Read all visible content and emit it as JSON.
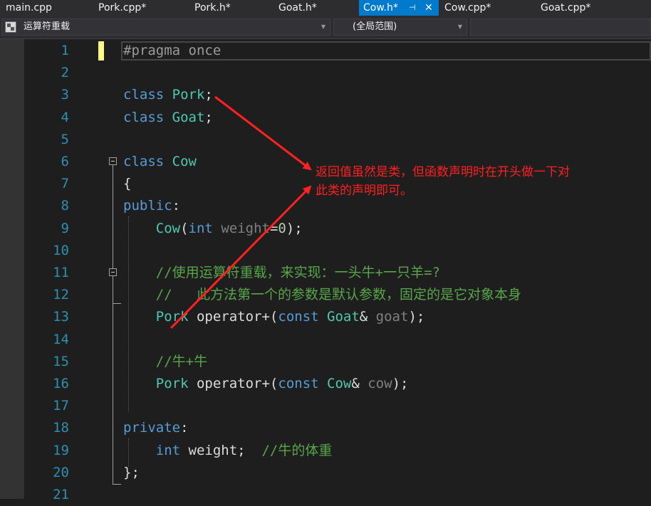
{
  "tabs": [
    {
      "label": "main.cpp"
    },
    {
      "label": "Pork.cpp*"
    },
    {
      "label": "Pork.h*"
    },
    {
      "label": "Goat.h*"
    },
    {
      "label": "Cow.h*",
      "active": true
    },
    {
      "label": "Cow.cpp*"
    },
    {
      "label": "Goat.cpp*"
    }
  ],
  "navigation": {
    "member_combo": "运算符重载",
    "scope_combo": "(全局范围)"
  },
  "editor": {
    "line_numbers": [
      "1",
      "2",
      "3",
      "4",
      "5",
      "6",
      "7",
      "8",
      "9",
      "10",
      "11",
      "12",
      "13",
      "14",
      "15",
      "16",
      "17",
      "18",
      "19",
      "20",
      "21"
    ],
    "lines": [
      {
        "segments": [
          {
            "text": "#pragma once",
            "cls": "pp"
          }
        ]
      },
      {
        "segments": []
      },
      {
        "segments": [
          {
            "text": "class ",
            "cls": "kw"
          },
          {
            "text": "Pork",
            "cls": "ty"
          },
          {
            "text": ";",
            "cls": ""
          }
        ]
      },
      {
        "segments": [
          {
            "text": "class ",
            "cls": "kw"
          },
          {
            "text": "Goat",
            "cls": "ty"
          },
          {
            "text": ";",
            "cls": ""
          }
        ]
      },
      {
        "segments": []
      },
      {
        "segments": [
          {
            "text": "class ",
            "cls": "kw"
          },
          {
            "text": "Cow",
            "cls": "ty"
          }
        ]
      },
      {
        "segments": [
          {
            "text": "{",
            "cls": ""
          }
        ]
      },
      {
        "segments": [
          {
            "text": "public",
            "cls": "kw"
          },
          {
            "text": ":",
            "cls": ""
          }
        ]
      },
      {
        "segments": [
          {
            "text": "    ",
            "cls": ""
          },
          {
            "text": "Cow",
            "cls": "ty"
          },
          {
            "text": "(",
            "cls": ""
          },
          {
            "text": "int ",
            "cls": "kw"
          },
          {
            "text": "weight",
            "cls": "pa"
          },
          {
            "text": "=",
            "cls": ""
          },
          {
            "text": "0",
            "cls": "num"
          },
          {
            "text": ");",
            "cls": ""
          }
        ]
      },
      {
        "segments": []
      },
      {
        "segments": [
          {
            "text": "    //使用运算符重载，来实现：一头牛+一只羊=?",
            "cls": "cm"
          }
        ]
      },
      {
        "segments": [
          {
            "text": "    //   此方法第一个的参数是默认参数，固定的是它对象本身",
            "cls": "cm"
          }
        ]
      },
      {
        "segments": [
          {
            "text": "    ",
            "cls": ""
          },
          {
            "text": "Pork",
            "cls": "ty"
          },
          {
            "text": " operator+(",
            "cls": ""
          },
          {
            "text": "const ",
            "cls": "kw"
          },
          {
            "text": "Goat",
            "cls": "ty"
          },
          {
            "text": "& ",
            "cls": ""
          },
          {
            "text": "goat",
            "cls": "pa"
          },
          {
            "text": ");",
            "cls": ""
          }
        ]
      },
      {
        "segments": []
      },
      {
        "segments": [
          {
            "text": "    //牛+牛",
            "cls": "cm"
          }
        ]
      },
      {
        "segments": [
          {
            "text": "    ",
            "cls": ""
          },
          {
            "text": "Pork",
            "cls": "ty"
          },
          {
            "text": " operator+(",
            "cls": ""
          },
          {
            "text": "const ",
            "cls": "kw"
          },
          {
            "text": "Cow",
            "cls": "ty"
          },
          {
            "text": "& ",
            "cls": ""
          },
          {
            "text": "cow",
            "cls": "pa"
          },
          {
            "text": ");",
            "cls": ""
          }
        ]
      },
      {
        "segments": []
      },
      {
        "segments": [
          {
            "text": "private",
            "cls": "kw"
          },
          {
            "text": ":",
            "cls": ""
          }
        ]
      },
      {
        "segments": [
          {
            "text": "    ",
            "cls": ""
          },
          {
            "text": "int ",
            "cls": "kw"
          },
          {
            "text": "weight;  ",
            "cls": ""
          },
          {
            "text": "//牛的体重",
            "cls": "cm"
          }
        ]
      },
      {
        "segments": [
          {
            "text": "};",
            "cls": ""
          }
        ]
      },
      {
        "segments": []
      }
    ]
  },
  "annotation": {
    "line1": "返回值虽然是类，但函数声明时在开头做一下对",
    "line2": "此类的声明即可。"
  },
  "colors": {
    "background": "#1e1e1e",
    "keyword": "#569cd6",
    "type": "#4ec9b0",
    "comment": "#57a64a",
    "line_number": "#2b91af",
    "active_tab": "#007acc",
    "annotation": "#ff2020"
  }
}
